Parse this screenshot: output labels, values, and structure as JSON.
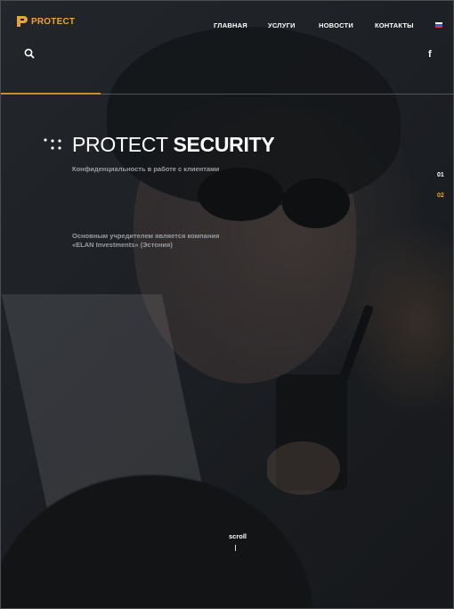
{
  "brand": {
    "name": "PROTECT",
    "accent_color": "#e8a23a",
    "icon": "shield-p-logo-icon"
  },
  "nav": {
    "items": [
      {
        "label": "ГЛАВНАЯ"
      },
      {
        "label": "УСЛУГИ"
      },
      {
        "label": "НОВОСТИ"
      },
      {
        "label": "КОНТАКТЫ"
      }
    ],
    "language_icon": "russian-flag-icon"
  },
  "toolbar": {
    "search_icon": "search-icon",
    "facebook_label": "f"
  },
  "hero": {
    "title_light": "PROTECT",
    "title_bold": "SECURITY",
    "subtitle": "Конфиденциальность в работе с клиентами",
    "description": "Основным учредителем является компания «ELAN Investments» (Эстония)"
  },
  "slider": {
    "items": [
      {
        "label": "01"
      },
      {
        "label": "02"
      }
    ],
    "active_index": 1
  },
  "scroll": {
    "label": "scroll"
  }
}
